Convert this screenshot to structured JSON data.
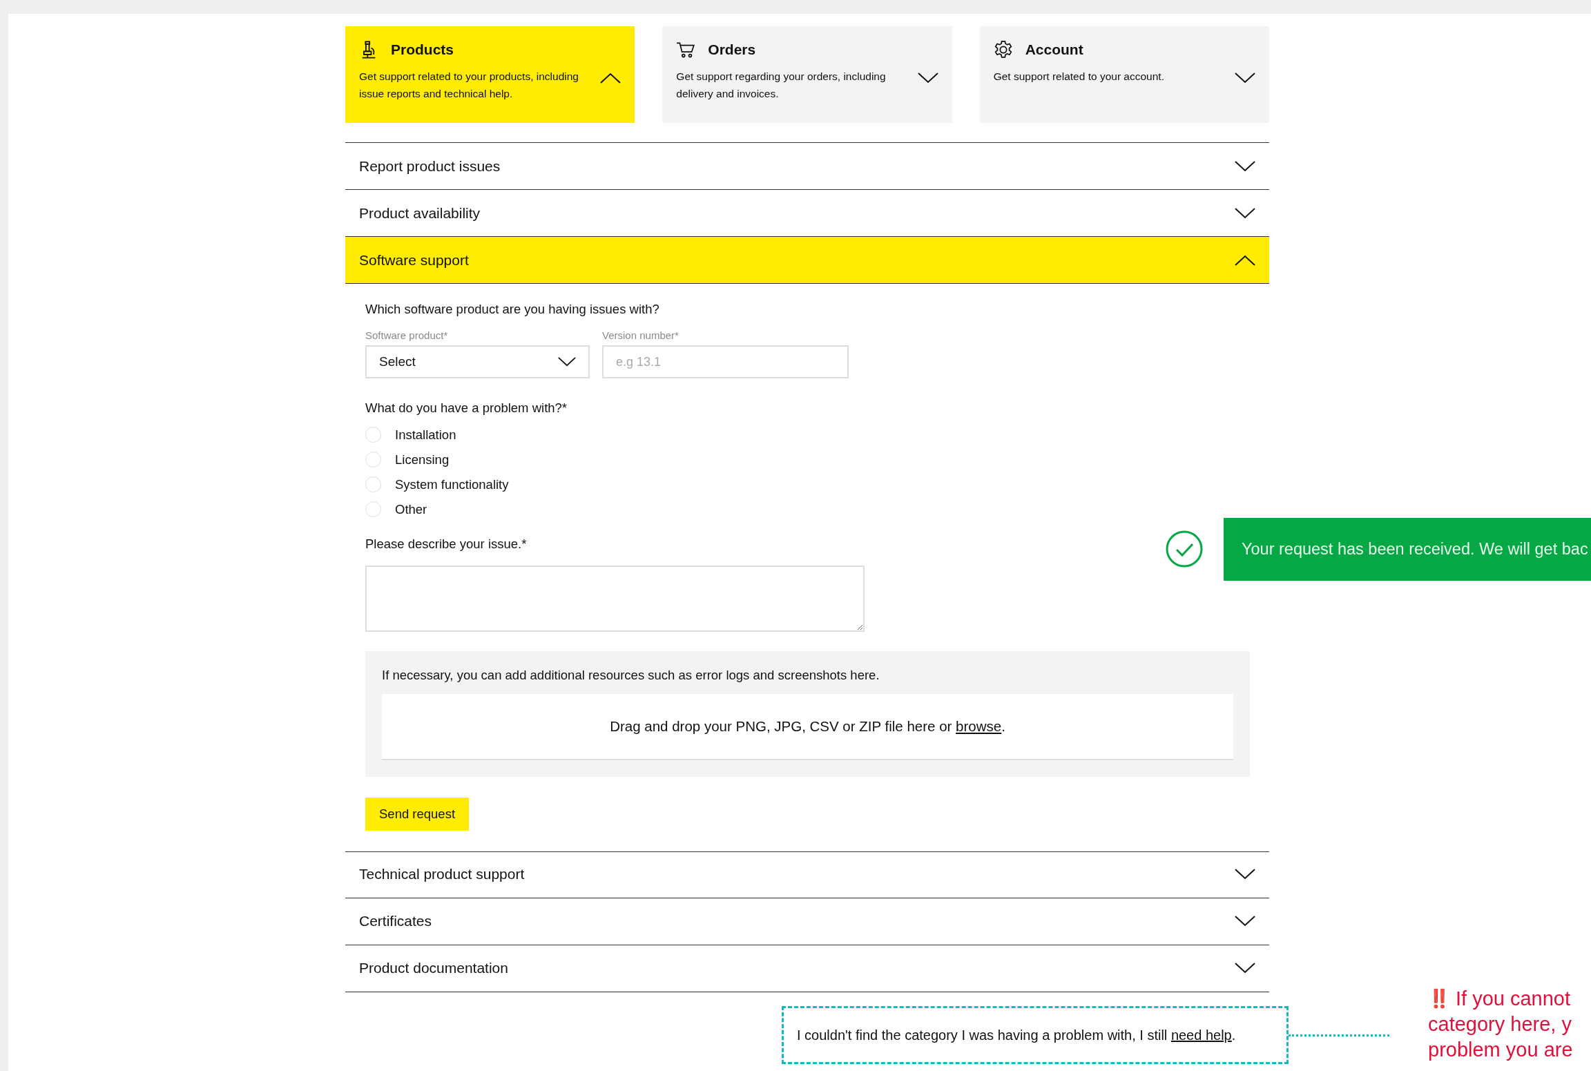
{
  "categories": [
    {
      "kind": "microscope",
      "title": "Products",
      "description": "Get support related to your products, including issue reports and technical help.",
      "selected": true
    },
    {
      "kind": "cart",
      "title": "Orders",
      "description": "Get support regarding your orders, including delivery and invoices.",
      "selected": false
    },
    {
      "kind": "gear",
      "title": "Account",
      "description": "Get support related to your account.",
      "selected": false
    }
  ],
  "sections": [
    {
      "label": "Report product issues",
      "expanded": false
    },
    {
      "label": "Product availability",
      "expanded": false
    },
    {
      "label": "Software support",
      "expanded": true
    },
    {
      "label": "Technical product support",
      "expanded": false
    },
    {
      "label": "Certificates",
      "expanded": false
    },
    {
      "label": "Product documentation",
      "expanded": false
    }
  ],
  "form": {
    "question": "Which software product are you having issues with?",
    "fields": [
      {
        "kind": "select",
        "label": "Software product*",
        "value": "Select"
      },
      {
        "kind": "text",
        "label": "Version number*",
        "placeholder": "e.g 13.1"
      }
    ],
    "problem_question": "What do you have a problem with?*",
    "options": [
      {
        "label": "Installation",
        "selected": false
      },
      {
        "label": "Licensing",
        "selected": false
      },
      {
        "label": "System functionality",
        "selected": false
      },
      {
        "label": "Other",
        "selected": false
      }
    ],
    "describe_label": "Please describe your issue.*",
    "attachments": {
      "note": "If necessary, you can add additional resources such as error logs and screenshots here.",
      "dropzone_text": "Drag and drop your PNG, JPG, CSV or ZIP file here or ",
      "link": "browse",
      "suffix": "."
    },
    "submit": "Send request"
  },
  "toast": {
    "message": "Your request has been received. We will get bac"
  },
  "help": {
    "text": "I couldn't find the category I was having a problem with, I still ",
    "link": "need help",
    "suffix": "."
  },
  "annotation": {
    "mark": "‼️",
    "lines": [
      "If you cannot",
      "category here, y",
      "problem you are"
    ]
  }
}
